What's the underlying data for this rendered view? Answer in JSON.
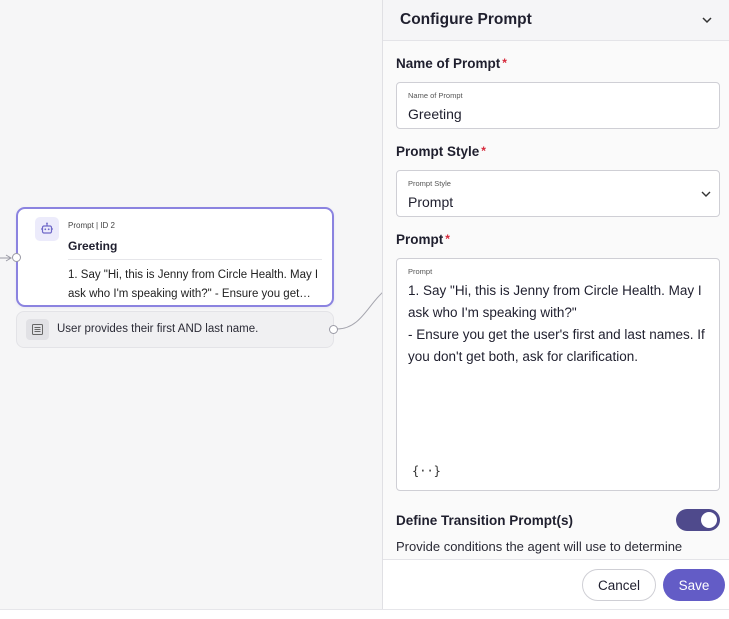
{
  "canvas": {
    "node": {
      "meta": "Prompt | ID 2",
      "title": "Greeting",
      "body": "1. Say \"Hi, this is Jenny from Circle Health. May I ask who I'm speaking with?\" - Ensure you get…",
      "icon": "robot-icon"
    },
    "transition": {
      "text": "User provides their first AND last name.",
      "icon": "list-icon"
    }
  },
  "panel": {
    "title": "Configure Prompt",
    "name_section": {
      "label": "Name of Prompt",
      "required": "*",
      "caption": "Name of Prompt",
      "value": "Greeting"
    },
    "style_section": {
      "label": "Prompt Style",
      "required": "*",
      "caption": "Prompt Style",
      "value": "Prompt"
    },
    "prompt_section": {
      "label": "Prompt",
      "required": "*",
      "caption": "Prompt",
      "value": "1. Say \"Hi, this is Jenny from Circle Health. May I ask who I'm speaking with?\"\n- Ensure you get the user's first and last names. If you don't get both, ask for clarification.",
      "variable_button": "{··}"
    },
    "transition_section": {
      "label": "Define Transition Prompt(s)",
      "toggle_on": true,
      "cut_text": "Provide conditions the agent will use to determine"
    },
    "footer": {
      "cancel_label": "Cancel",
      "save_label": "Save"
    }
  },
  "colors": {
    "accent": "#635cc6",
    "node_border": "#8b83e0",
    "toggle_on": "#4f4a8c",
    "required": "#d6283a"
  }
}
